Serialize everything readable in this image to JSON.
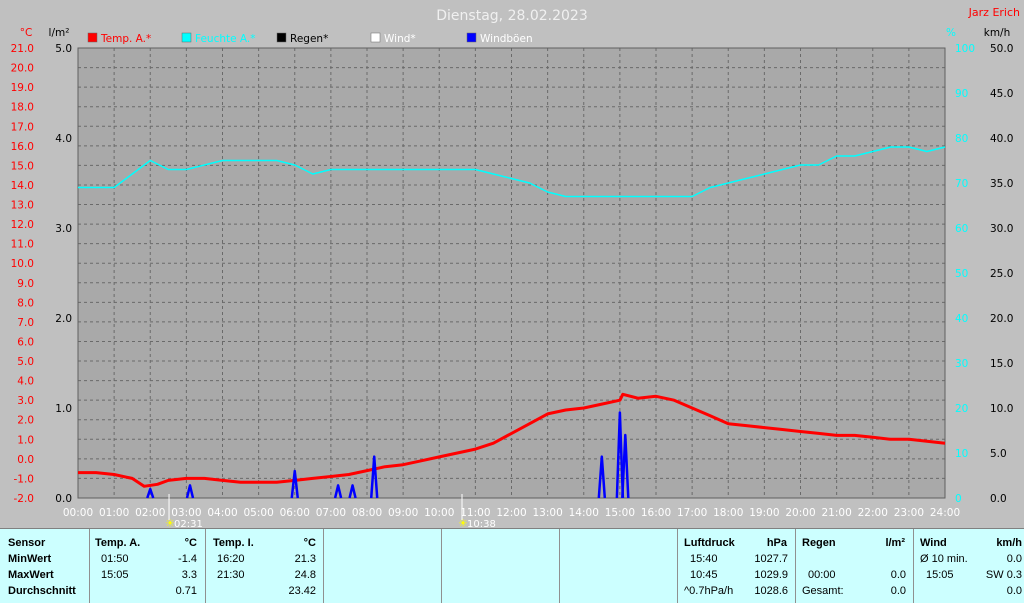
{
  "chart_data": {
    "type": "line",
    "title": "Dienstag, 28.02.2023",
    "station": "Jarz Erich",
    "axes": {
      "temp": {
        "unit": "°C",
        "range": [
          -2.0,
          21.0
        ],
        "ticks": [
          "-2.0",
          "-1.0",
          "0.0",
          "1.0",
          "2.0",
          "3.0",
          "4.0",
          "5.0",
          "6.0",
          "7.0",
          "8.0",
          "9.0",
          "10.0",
          "11.0",
          "12.0",
          "13.0",
          "14.0",
          "15.0",
          "16.0",
          "17.0",
          "18.0",
          "19.0",
          "20.0",
          "21.0"
        ]
      },
      "rain": {
        "unit": "l/m²",
        "range": [
          0.0,
          5.0
        ],
        "ticks": [
          "0.0",
          "1.0",
          "2.0",
          "3.0",
          "4.0",
          "5.0"
        ]
      },
      "humidity": {
        "unit": "%",
        "range": [
          0,
          100
        ],
        "ticks": [
          "0",
          "10",
          "20",
          "30",
          "40",
          "50",
          "60",
          "70",
          "80",
          "90",
          "100"
        ]
      },
      "wind": {
        "unit": "km/h",
        "range": [
          0.0,
          50.0
        ],
        "ticks": [
          "0.0",
          "5.0",
          "10.0",
          "15.0",
          "20.0",
          "25.0",
          "30.0",
          "35.0",
          "40.0",
          "45.0",
          "50.0"
        ]
      }
    },
    "x_ticks": [
      "00:00",
      "01:00",
      "02:00",
      "03:00",
      "04:00",
      "05:00",
      "06:00",
      "07:00",
      "08:00",
      "09:00",
      "10:00",
      "11:00",
      "12:00",
      "13:00",
      "14:00",
      "15:00",
      "16:00",
      "17:00",
      "18:00",
      "19:00",
      "20:00",
      "21:00",
      "22:00",
      "23:00",
      "24:00"
    ],
    "markers": [
      {
        "x": 2.52,
        "label": "02:31"
      },
      {
        "x": 10.63,
        "label": "10:38"
      }
    ],
    "legend": [
      {
        "name": "Temp. A.*",
        "color": "#ff0000",
        "text_color": "#ff0000"
      },
      {
        "name": "Feuchte A.*",
        "color": "#00ffff",
        "text_color": "#00ffff"
      },
      {
        "name": "Regen*",
        "color": "#000000",
        "text_color": "#000000"
      },
      {
        "name": "Wind*",
        "color": "#ffffff",
        "text_color": "#ffffff"
      },
      {
        "name": "Windböen",
        "color": "#0000ff",
        "text_color": "#ffffff"
      }
    ],
    "series": [
      {
        "name": "Temp. A.*",
        "axis": "temp",
        "color": "#ff0000",
        "x": [
          0,
          0.5,
          1,
          1.5,
          1.83,
          2.2,
          2.5,
          3,
          3.5,
          4,
          4.5,
          5,
          5.5,
          6,
          6.5,
          7,
          7.5,
          8,
          8.5,
          9,
          9.5,
          10,
          10.5,
          11,
          11.5,
          12,
          12.5,
          13,
          13.5,
          14,
          14.5,
          15,
          15.08,
          15.5,
          16,
          16.5,
          17,
          17.5,
          18,
          18.5,
          19,
          19.5,
          20,
          20.5,
          21,
          21.5,
          22,
          22.5,
          23,
          23.5,
          24
        ],
        "y": [
          -0.7,
          -0.7,
          -0.8,
          -1.0,
          -1.4,
          -1.3,
          -1.1,
          -1.0,
          -1.0,
          -1.1,
          -1.2,
          -1.2,
          -1.2,
          -1.1,
          -1.0,
          -0.9,
          -0.8,
          -0.6,
          -0.4,
          -0.3,
          -0.1,
          0.1,
          0.3,
          0.5,
          0.8,
          1.3,
          1.8,
          2.3,
          2.5,
          2.6,
          2.8,
          3.0,
          3.3,
          3.1,
          3.2,
          3.0,
          2.6,
          2.2,
          1.8,
          1.7,
          1.6,
          1.5,
          1.4,
          1.3,
          1.2,
          1.2,
          1.1,
          1.0,
          1.0,
          0.9,
          0.8
        ]
      },
      {
        "name": "Feuchte A.*",
        "axis": "humidity",
        "color": "#00ffff",
        "x": [
          0,
          0.5,
          1,
          1.5,
          2,
          2.5,
          3,
          3.5,
          4,
          4.5,
          5,
          5.5,
          6,
          6.5,
          7,
          7.5,
          8,
          8.5,
          9,
          9.5,
          10,
          10.5,
          11,
          11.5,
          12,
          12.5,
          13,
          13.5,
          14,
          14.5,
          15,
          15.5,
          16,
          16.5,
          17,
          17.5,
          18,
          18.5,
          19,
          19.5,
          20,
          20.5,
          21,
          21.5,
          22,
          22.5,
          23,
          23.5,
          24
        ],
        "y": [
          69,
          69,
          69,
          72,
          75,
          73,
          73,
          74,
          75,
          75,
          75,
          75,
          74,
          72,
          73,
          73,
          73,
          73,
          73,
          73,
          73,
          73,
          73,
          72,
          71,
          70,
          68,
          67,
          67,
          67,
          67,
          67,
          67,
          67,
          67,
          69,
          70,
          71,
          72,
          73,
          74,
          74,
          76,
          76,
          77,
          78,
          78,
          77,
          78
        ]
      },
      {
        "name": "Regen*",
        "axis": "rain",
        "color": "#000000",
        "x": [],
        "y": []
      },
      {
        "name": "Wind*",
        "axis": "wind",
        "color": "#ffffff",
        "x": [],
        "y": []
      },
      {
        "name": "Windböen",
        "axis": "wind",
        "color": "#0000ff",
        "gusts": [
          [
            2.0,
            1.0
          ],
          [
            3.1,
            1.4
          ],
          [
            6.0,
            3.0
          ],
          [
            7.2,
            1.4
          ],
          [
            7.6,
            1.4
          ],
          [
            8.2,
            4.6
          ],
          [
            14.5,
            4.6
          ],
          [
            15.0,
            9.5
          ],
          [
            15.15,
            7.0
          ]
        ]
      }
    ]
  },
  "summary": {
    "sensor": {
      "header": "Sensor",
      "rows": [
        "MinWert",
        "MaxWert",
        "Durchschnitt"
      ]
    },
    "temp_a": {
      "header": "Temp. A.",
      "unit": "°C",
      "rows": [
        [
          "01:50",
          "-1.4"
        ],
        [
          "15:05",
          "3.3"
        ],
        [
          "",
          "0.71"
        ]
      ]
    },
    "temp_i": {
      "header": "Temp. I.",
      "unit": "°C",
      "rows": [
        [
          "16:20",
          "21.3"
        ],
        [
          "21:30",
          "24.8"
        ],
        [
          "",
          "23.42"
        ]
      ]
    },
    "luftdruck": {
      "header": "Luftdruck",
      "unit": "hPa",
      "rows": [
        [
          "15:40",
          "1027.7"
        ],
        [
          "10:45",
          "1029.9"
        ],
        [
          "^0.7hPa/h",
          "1028.6"
        ]
      ]
    },
    "regen": {
      "header": "Regen",
      "unit": "l/m²",
      "rows": [
        [
          "",
          ""
        ],
        [
          "00:00",
          "0.0"
        ],
        [
          "Gesamt:",
          "0.0"
        ]
      ]
    },
    "wind": {
      "header": "Wind",
      "unit": "km/h",
      "rows": [
        [
          "Ø 10 min.",
          "0.0"
        ],
        [
          "15:05",
          "SW 0.3"
        ],
        [
          "",
          "0.0"
        ]
      ]
    }
  }
}
